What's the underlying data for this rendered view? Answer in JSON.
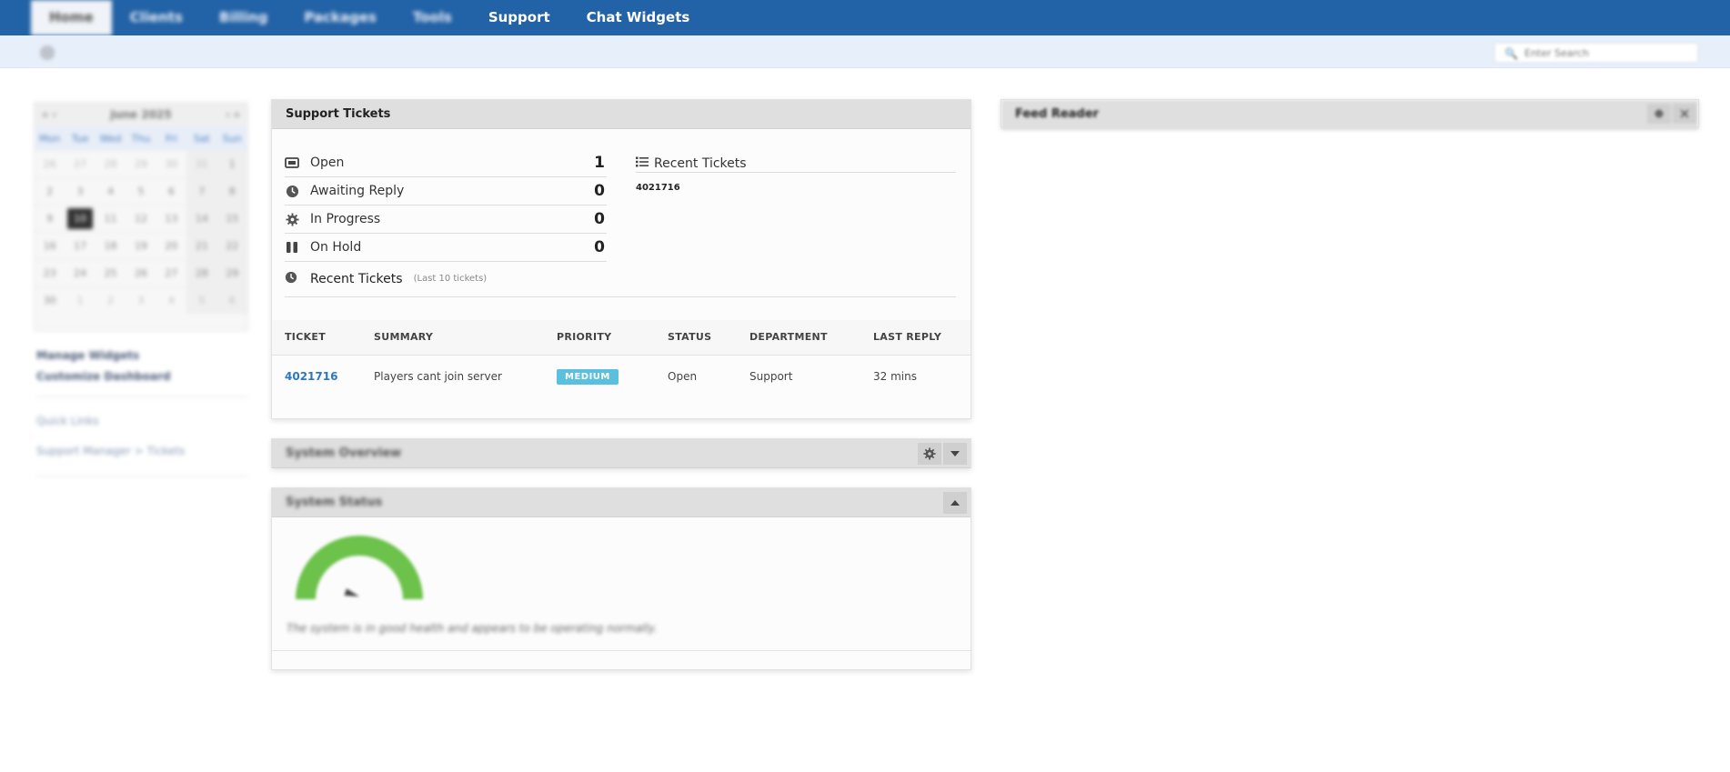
{
  "nav": {
    "tabs": [
      "Home",
      "Clients",
      "Billing",
      "Packages",
      "Tools",
      "Support",
      "Chat Widgets"
    ]
  },
  "search": {
    "placeholder": "Enter Search"
  },
  "calendar": {
    "prev": "« ‹",
    "month": "June 2025",
    "next": "› »",
    "days_of_week": [
      "Mon",
      "Tue",
      "Wed",
      "Thu",
      "Fri",
      "Sat",
      "Sun"
    ],
    "weeks": [
      [
        "26",
        "27",
        "28",
        "29",
        "30",
        "31",
        "1"
      ],
      [
        "2",
        "3",
        "4",
        "5",
        "6",
        "7",
        "8"
      ],
      [
        "9",
        "10",
        "11",
        "12",
        "13",
        "14",
        "15"
      ],
      [
        "16",
        "17",
        "18",
        "19",
        "20",
        "21",
        "22"
      ],
      [
        "23",
        "24",
        "25",
        "26",
        "27",
        "28",
        "29"
      ],
      [
        "30",
        "1",
        "2",
        "3",
        "4",
        "5",
        "6"
      ]
    ],
    "today": "10"
  },
  "sidebar": {
    "manage_widgets": "Manage Widgets",
    "customize_dashboard": "Customize Dashboard",
    "quick_links": "Quick Links",
    "breadcrumb": "Support Manager > Tickets"
  },
  "support_tickets": {
    "title": "Support Tickets",
    "stats": [
      {
        "label": "Open",
        "count": "1",
        "icon": "ticket-icon"
      },
      {
        "label": "Awaiting Reply",
        "count": "0",
        "icon": "clock-icon"
      },
      {
        "label": "In Progress",
        "count": "0",
        "icon": "gear-icon"
      },
      {
        "label": "On Hold",
        "count": "0",
        "icon": "pause-icon"
      }
    ],
    "recent_label": "Recent Tickets",
    "recent_sub": "(Last 10 tickets)",
    "recent_side_title": "Recent Tickets",
    "recent_side_ticket": "4021716",
    "table": {
      "headers": [
        "TICKET",
        "SUMMARY",
        "PRIORITY",
        "STATUS",
        "DEPARTMENT",
        "LAST REPLY"
      ],
      "rows": [
        {
          "ticket": "4021716",
          "summary": "Players cant join server",
          "priority": "MEDIUM",
          "status": "Open",
          "department": "Support",
          "last_reply": "32 mins"
        }
      ]
    }
  },
  "system_overview": {
    "title": "System Overview"
  },
  "system_status": {
    "title": "System Status",
    "message": "The system is in good health and appears to be operating normally.",
    "health_level": 0.1
  },
  "feed_reader": {
    "title": "Feed Reader"
  },
  "colors": {
    "nav_bg": "#2262a6",
    "link": "#2c77bd",
    "badge_medium": "#5bc0de",
    "gauge_green": "#6cc24a"
  }
}
